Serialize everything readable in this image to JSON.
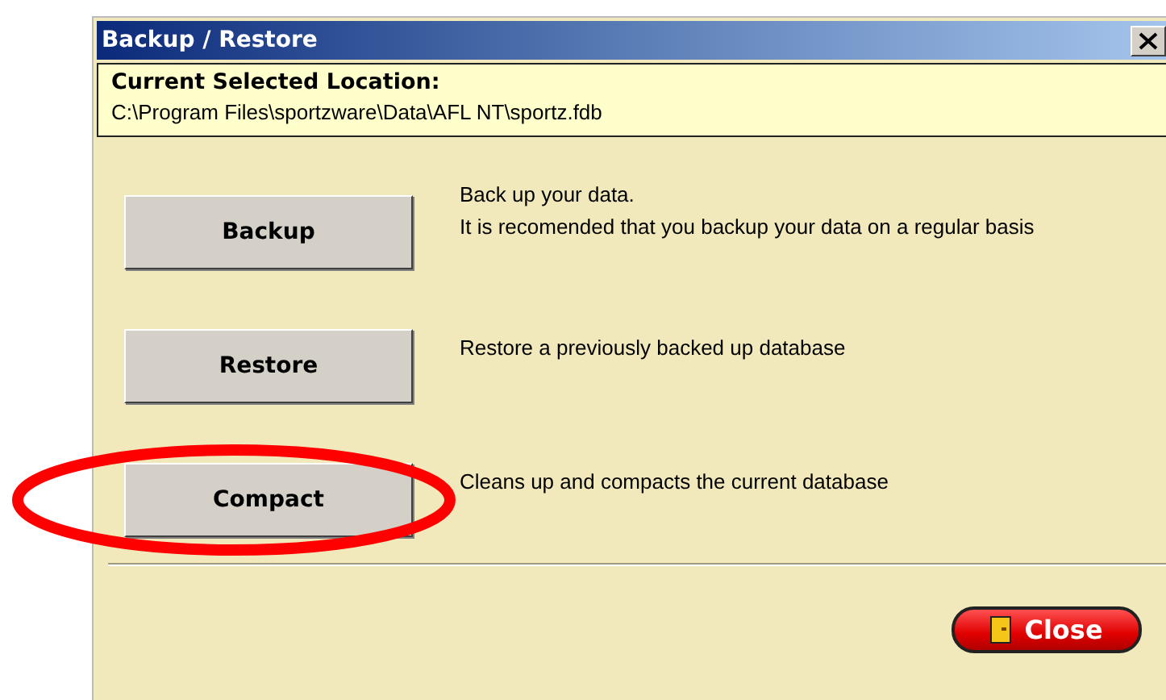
{
  "window": {
    "title": "Backup / Restore"
  },
  "location": {
    "heading": "Current Selected Location:",
    "path": "C:\\Program Files\\sportzware\\Data\\AFL NT\\sportz.fdb"
  },
  "actions": [
    {
      "label": "Backup",
      "description": [
        "Back up your data.",
        "It is recomended that you backup your data on a regular basis"
      ],
      "highlighted": false
    },
    {
      "label": "Restore",
      "description": [
        "Restore a previously backed up database"
      ],
      "highlighted": false
    },
    {
      "label": "Compact",
      "description": [
        "Cleans up and compacts the current database"
      ],
      "highlighted": true
    }
  ],
  "close_button": {
    "label": "Close"
  }
}
